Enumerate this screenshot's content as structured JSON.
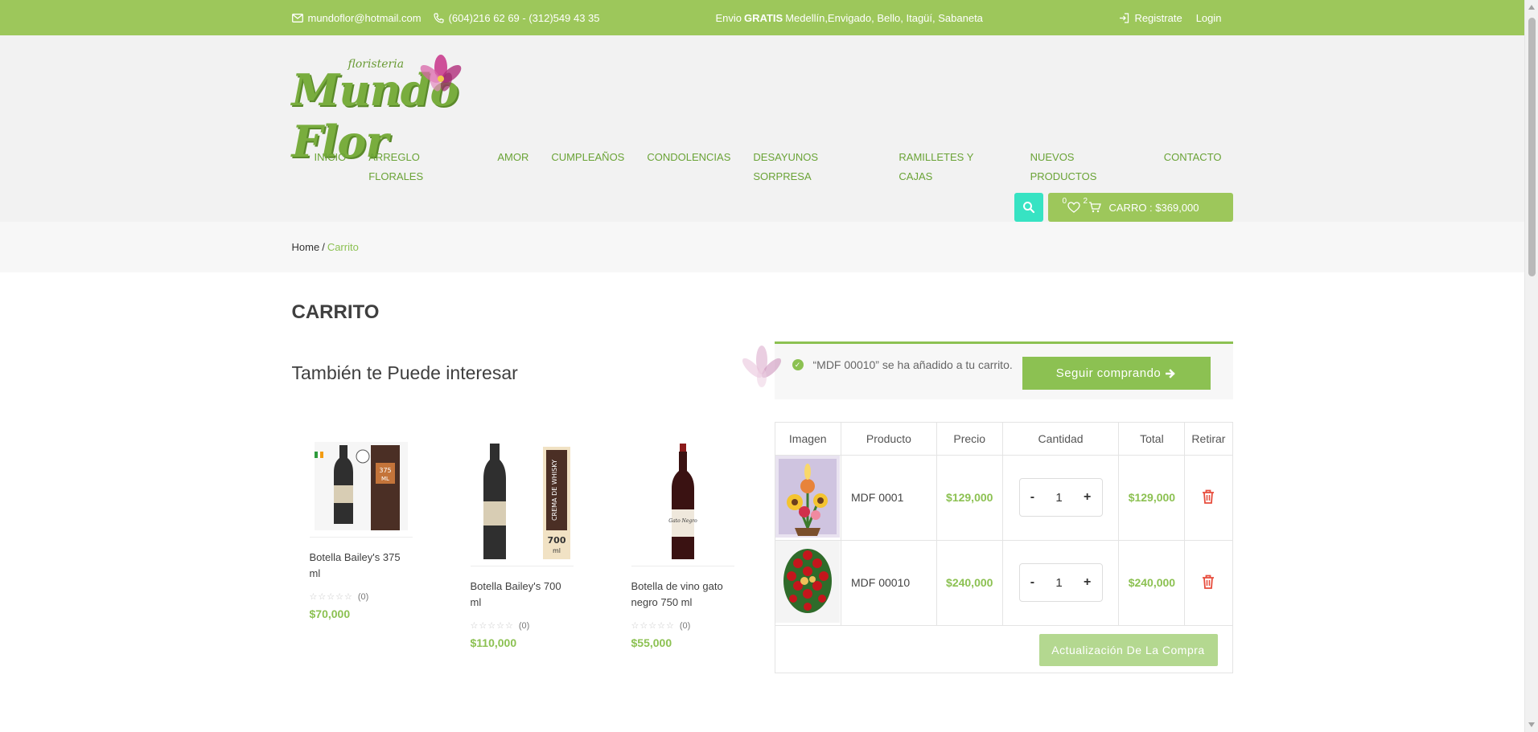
{
  "topbar": {
    "email": "mundoflor@hotmail.com",
    "phones": "(604)216 62 69 - (312)549 43 35",
    "promo_prefix": "Envio",
    "promo_bold": "GRATIS",
    "promo_suffix": "Medellín,Envigado, Bello, Itagüí, Sabaneta",
    "register": "Registrate",
    "login": "Login"
  },
  "logo": {
    "brand": "Mundo Flor",
    "sub": "floristeria"
  },
  "nav": [
    "INICIO",
    "ARREGLO FLORALES",
    "AMOR",
    "CUMPLEAÑOS",
    "CONDOLENCIAS",
    "DESAYUNOS SORPRESA",
    "RAMILLETES Y CAJAS",
    "NUEVOS PRODUCTOS",
    "CONTACTO"
  ],
  "header_tools": {
    "wishlist_count": "0",
    "cart_count": "2",
    "cart_label": "CARRO : $369,000"
  },
  "breadcrumb": {
    "home": "Home",
    "separator": "/",
    "current": "Carrito"
  },
  "page_title": "CARRITO",
  "related": {
    "heading": "También te Puede interesar",
    "products": [
      {
        "name": "Botella Bailey's 375 ml",
        "reviews": "(0)",
        "price": "$70,000"
      },
      {
        "name": "Botella Bailey's 700 ml",
        "reviews": "(0)",
        "price": "$110,000"
      },
      {
        "name": "Botella de vino gato negro 750 ml",
        "reviews": "(0)",
        "price": "$55,000"
      }
    ]
  },
  "notice": {
    "message": "“MDF 00010” se ha añadido a tu carrito.",
    "button": "Seguir comprando"
  },
  "cart": {
    "headers": [
      "Imagen",
      "Producto",
      "Precio",
      "Cantidad",
      "Total",
      "Retirar"
    ],
    "rows": [
      {
        "product": "MDF 0001",
        "price": "$129,000",
        "qty": "1",
        "total": "$129,000"
      },
      {
        "product": "MDF 00010",
        "price": "$240,000",
        "qty": "1",
        "total": "$240,000"
      }
    ],
    "minus": "-",
    "plus": "+",
    "update": "Actualización De La Compra"
  },
  "colors": {
    "brand_green": "#9dc75b",
    "price_green": "#8cc152",
    "search_teal": "#37e3c3",
    "delete_red": "#e74c3c"
  }
}
